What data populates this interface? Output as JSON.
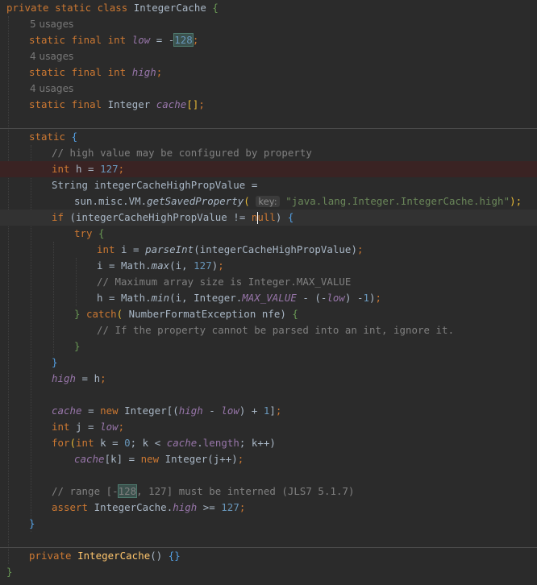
{
  "editor": {
    "language": "Java",
    "hints": {
      "usages_low": "5 usages",
      "usages_high": "4 usages",
      "usages_cache": "4 usages",
      "param_key": "key:"
    },
    "code": {
      "l1_private": "private",
      "l1_static": "static",
      "l1_class": "class",
      "l1_name": "IntegerCache",
      "l1_brace": "{",
      "low_static": "static",
      "low_final": "final",
      "low_int": "int",
      "low_name": "low",
      "low_eq": " = -",
      "low_val": "128",
      "semi": ";",
      "high_static": "static",
      "high_final": "final",
      "high_int": "int",
      "high_name": "high",
      "cache_static": "static",
      "cache_final": "final",
      "cache_type": "Integer",
      "cache_name": "cache",
      "cache_arr": "[]",
      "static_kw": "static",
      "open_brace": "{",
      "comment1": "// high value may be configured by property",
      "h_int": "int",
      "h_decl": " h = ",
      "h_val": "127",
      "str_decl": "String integerCacheHighPropValue =",
      "saved_prefix": "sun.misc.VM.",
      "saved_method": "getSavedProperty",
      "saved_open": "(",
      "saved_str": "\"java.lang.Integer.IntegerCache.high\"",
      "saved_close": ");",
      "if_kw": "if",
      "if_cond": " (integerCacheHighPropValue != ",
      "if_null_a": "n",
      "if_null_b": "ull",
      "if_close": ") ",
      "try_kw": "try",
      "parse_int": "int",
      "parse_lhs": " i = ",
      "parse_m": "parseInt",
      "parse_args": "(integerCacheHighPropValue)",
      "max_lhs": "i = Math.",
      "max_m": "max",
      "max_args_a": "(i, ",
      "max_val": "127",
      "max_args_b": ")",
      "comment2": "// Maximum array size is Integer.MAX_VALUE",
      "min_lhs": "h = Math.",
      "min_m": "min",
      "min_a": "(i, Integer.",
      "min_const": "MAX_VALUE",
      "min_b": " - (-",
      "min_low": "low",
      "min_c": ") -",
      "min_one": "1",
      "min_d": ")",
      "catch_close": "}",
      "catch_kw": "catch",
      "catch_open": "( ",
      "catch_args": "NumberFormatException nfe) ",
      "comment3": "// If the property cannot be parsed into an int, ignore it.",
      "close": "}",
      "high_assign": "high",
      "high_assign_rest": " = h",
      "cache_assign": "cache",
      "cache_eq": " = ",
      "new_kw": "new",
      "cache_new_a": " Integer[(",
      "cache_new_high": "high",
      "cache_new_b": " - ",
      "cache_new_low": "low",
      "cache_new_c": ") + ",
      "cache_new_one": "1",
      "cache_new_d": "]",
      "j_int": "int",
      "j_decl": " j = ",
      "j_low": "low",
      "for_kw": "for",
      "for_a": "(",
      "for_int": "int",
      "for_b": " k = ",
      "for_zero": "0",
      "for_c": "; k < ",
      "for_cache": "cache",
      "for_d": ".",
      "for_len": "length",
      "for_e": "; k++)",
      "assign_cache": "cache",
      "assign_a": "[k] = ",
      "assign_new": "new",
      "assign_b": " Integer(j++)",
      "comment4_a": "// range [-",
      "comment4_num": "128",
      "comment4_b": ", 127] must be interned (JLS7 5.1.7)",
      "assert_kw": "assert",
      "assert_a": " IntegerCache.",
      "assert_high": "high",
      "assert_b": " >= ",
      "assert_val": "127",
      "ctor_private": "private",
      "ctor_name": "IntegerCache",
      "ctor_parens": "() ",
      "ctor_body": "{}",
      "final_close": "}"
    }
  }
}
